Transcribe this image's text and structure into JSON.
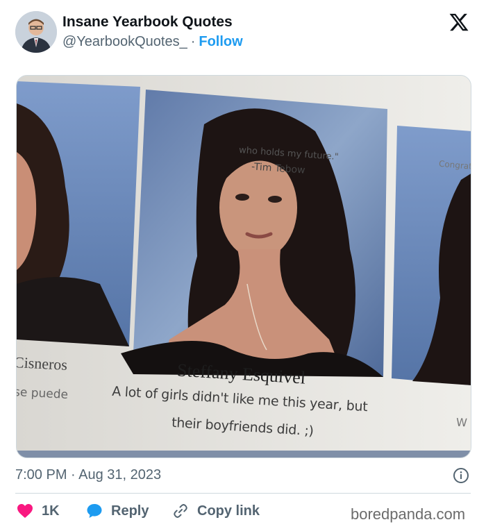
{
  "tweet": {
    "author_name": "Insane Yearbook Quotes",
    "handle": "@YearbookQuotes_",
    "separator": "·",
    "follow_label": "Follow",
    "timestamp": "7:00 PM · Aug 31, 2023"
  },
  "image": {
    "student_name": "Steffany Esquivel",
    "quote_line1": "A lot of girls didn't like me this year, but",
    "quote_line2": "their boyfriends did. ;)",
    "left_name": "Cisneros",
    "left_quote": "se puede",
    "top_line1": "who holds my future.\"",
    "top_line2": "-Tim Tebow",
    "top_right": "Congrats",
    "right_fragment": "W"
  },
  "actions": {
    "like_count": "1K",
    "reply_label": "Reply",
    "copy_label": "Copy link"
  },
  "watermark": "boredpanda.com",
  "colors": {
    "accent": "#1d9bf0",
    "like": "#f91880",
    "muted": "#536471",
    "text": "#0f1419"
  },
  "icons": [
    "x-logo-icon",
    "heart-icon",
    "reply-bubble-icon",
    "link-icon",
    "info-icon"
  ]
}
